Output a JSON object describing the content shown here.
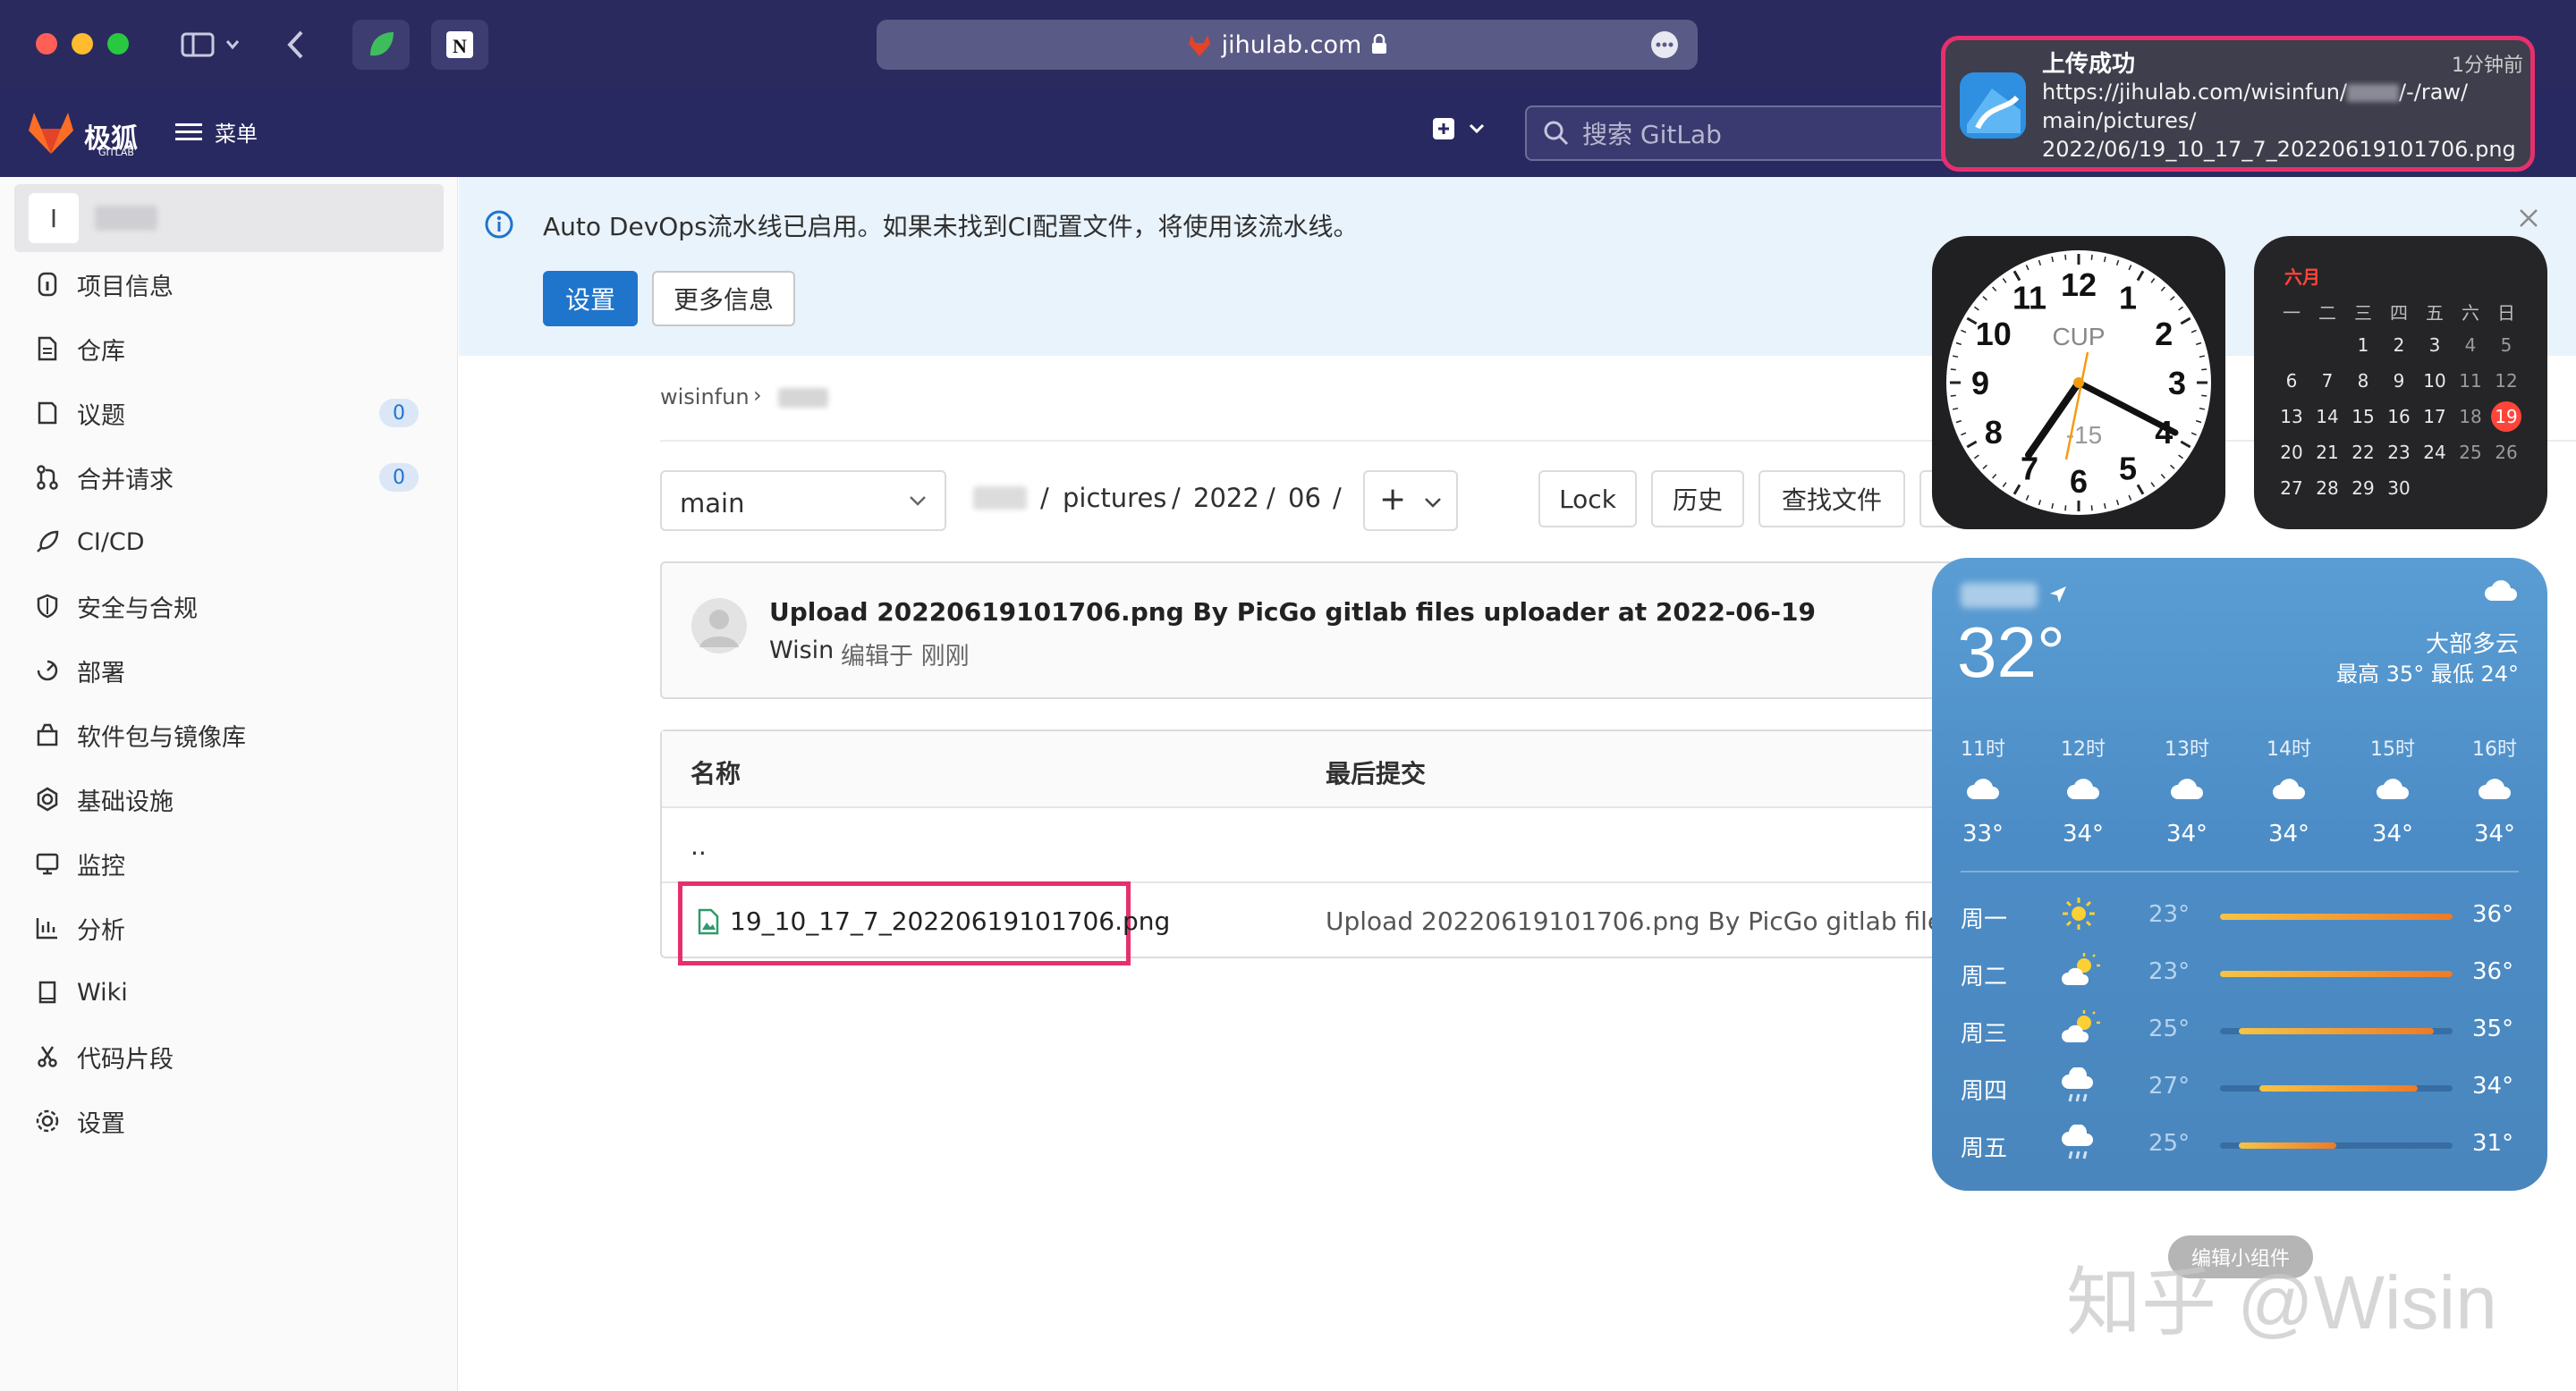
{
  "browser": {
    "address": "jihulab.com"
  },
  "gitlab_header": {
    "logo_text": "极狐",
    "logo_sub": "GITLAB",
    "menu_label": "菜单",
    "search_placeholder": "搜索 GitLab"
  },
  "sidebar": {
    "project_initial": "I",
    "items": [
      {
        "label": "项目信息",
        "icon": "info-icon"
      },
      {
        "label": "仓库",
        "icon": "document-icon"
      },
      {
        "label": "议题",
        "icon": "issues-icon",
        "count": "0"
      },
      {
        "label": "合并请求",
        "icon": "merge-request-icon",
        "count": "0"
      },
      {
        "label": "CI/CD",
        "icon": "rocket-icon"
      },
      {
        "label": "安全与合规",
        "icon": "shield-icon"
      },
      {
        "label": "部署",
        "icon": "deploy-icon"
      },
      {
        "label": "软件包与镜像库",
        "icon": "package-icon"
      },
      {
        "label": "基础设施",
        "icon": "cloud-gear-icon"
      },
      {
        "label": "监控",
        "icon": "monitor-icon"
      },
      {
        "label": "分析",
        "icon": "chart-icon"
      },
      {
        "label": "Wiki",
        "icon": "book-icon"
      },
      {
        "label": "代码片段",
        "icon": "scissors-icon"
      },
      {
        "label": "设置",
        "icon": "gear-icon"
      }
    ]
  },
  "banner": {
    "message": "Auto DevOps流水线已启用。如果未找到CI配置文件，将使用该流水线。",
    "settings_button": "设置",
    "more_info_button": "更多信息"
  },
  "breadcrumb": {
    "owner": "wisinfun",
    "separator": "›"
  },
  "repo": {
    "branch": "main",
    "path": [
      "pictures",
      "2022",
      "06"
    ],
    "path_sep": "/",
    "add_button": "+",
    "lock_button": "Lock",
    "history_button": "历史",
    "find_file_button": "查找文件"
  },
  "commit": {
    "title": "Upload 20220619101706.png By PicGo gitlab files uploader at 2022-06-19",
    "author": "Wisin",
    "meta": "编辑于 刚刚"
  },
  "file_table": {
    "headers": [
      "名称",
      "最后提交"
    ],
    "parent": "..",
    "rows": [
      {
        "name": "19_10_17_7_20220619101706.png",
        "last_commit": "Upload 20220619101706.png By PicGo gitlab files up"
      }
    ]
  },
  "notification": {
    "title": "上传成功",
    "time": "1分钟前",
    "lines": [
      "https://jihulab.com/wisinfun/",
      "/-/raw/",
      "main/pictures/",
      "2022/06/19_10_17_7_20220619101706.png"
    ]
  },
  "clock_widget": {
    "label": "CUP",
    "offset": "-15",
    "numbers": [
      "12",
      "1",
      "2",
      "3",
      "4",
      "5",
      "6",
      "7",
      "8",
      "9",
      "10",
      "11"
    ]
  },
  "calendar_widget": {
    "month": "六月",
    "weekdays": [
      "一",
      "二",
      "三",
      "四",
      "五",
      "六",
      "日"
    ],
    "days": [
      [
        "",
        "",
        "1",
        "2",
        "3",
        "4",
        "5"
      ],
      [
        "6",
        "7",
        "8",
        "9",
        "10",
        "11",
        "12"
      ],
      [
        "13",
        "14",
        "15",
        "16",
        "17",
        "18",
        "19"
      ],
      [
        "20",
        "21",
        "22",
        "23",
        "24",
        "25",
        "26"
      ],
      [
        "27",
        "28",
        "29",
        "30",
        "",
        "",
        ""
      ]
    ],
    "today": "19"
  },
  "weather_widget": {
    "temp": "32°",
    "condition": "大部多云",
    "high_low": "最高 35° 最低 24°",
    "hourly": [
      {
        "time": "11时",
        "temp": "33°"
      },
      {
        "time": "12时",
        "temp": "34°"
      },
      {
        "time": "13时",
        "temp": "34°"
      },
      {
        "time": "14时",
        "temp": "34°"
      },
      {
        "time": "15时",
        "temp": "34°"
      },
      {
        "time": "16时",
        "temp": "34°"
      }
    ],
    "daily": [
      {
        "day": "周一",
        "low": "23°",
        "high": "36°",
        "icon": "sun-icon",
        "range_start": 0.0,
        "range_end": 1.0
      },
      {
        "day": "周二",
        "low": "23°",
        "high": "36°",
        "icon": "sun-cloud-icon",
        "range_start": 0.0,
        "range_end": 1.0
      },
      {
        "day": "周三",
        "low": "25°",
        "high": "35°",
        "icon": "sun-cloud-icon",
        "range_start": 0.08,
        "range_end": 0.92
      },
      {
        "day": "周四",
        "low": "27°",
        "high": "34°",
        "icon": "rain-cloud-icon",
        "range_start": 0.17,
        "range_end": 0.85
      },
      {
        "day": "周五",
        "low": "25°",
        "high": "31°",
        "icon": "rain-cloud-icon",
        "range_start": 0.08,
        "range_end": 0.5
      }
    ]
  },
  "edit_widgets_button": "编辑小组件",
  "watermark": "知乎 @Wisin"
}
